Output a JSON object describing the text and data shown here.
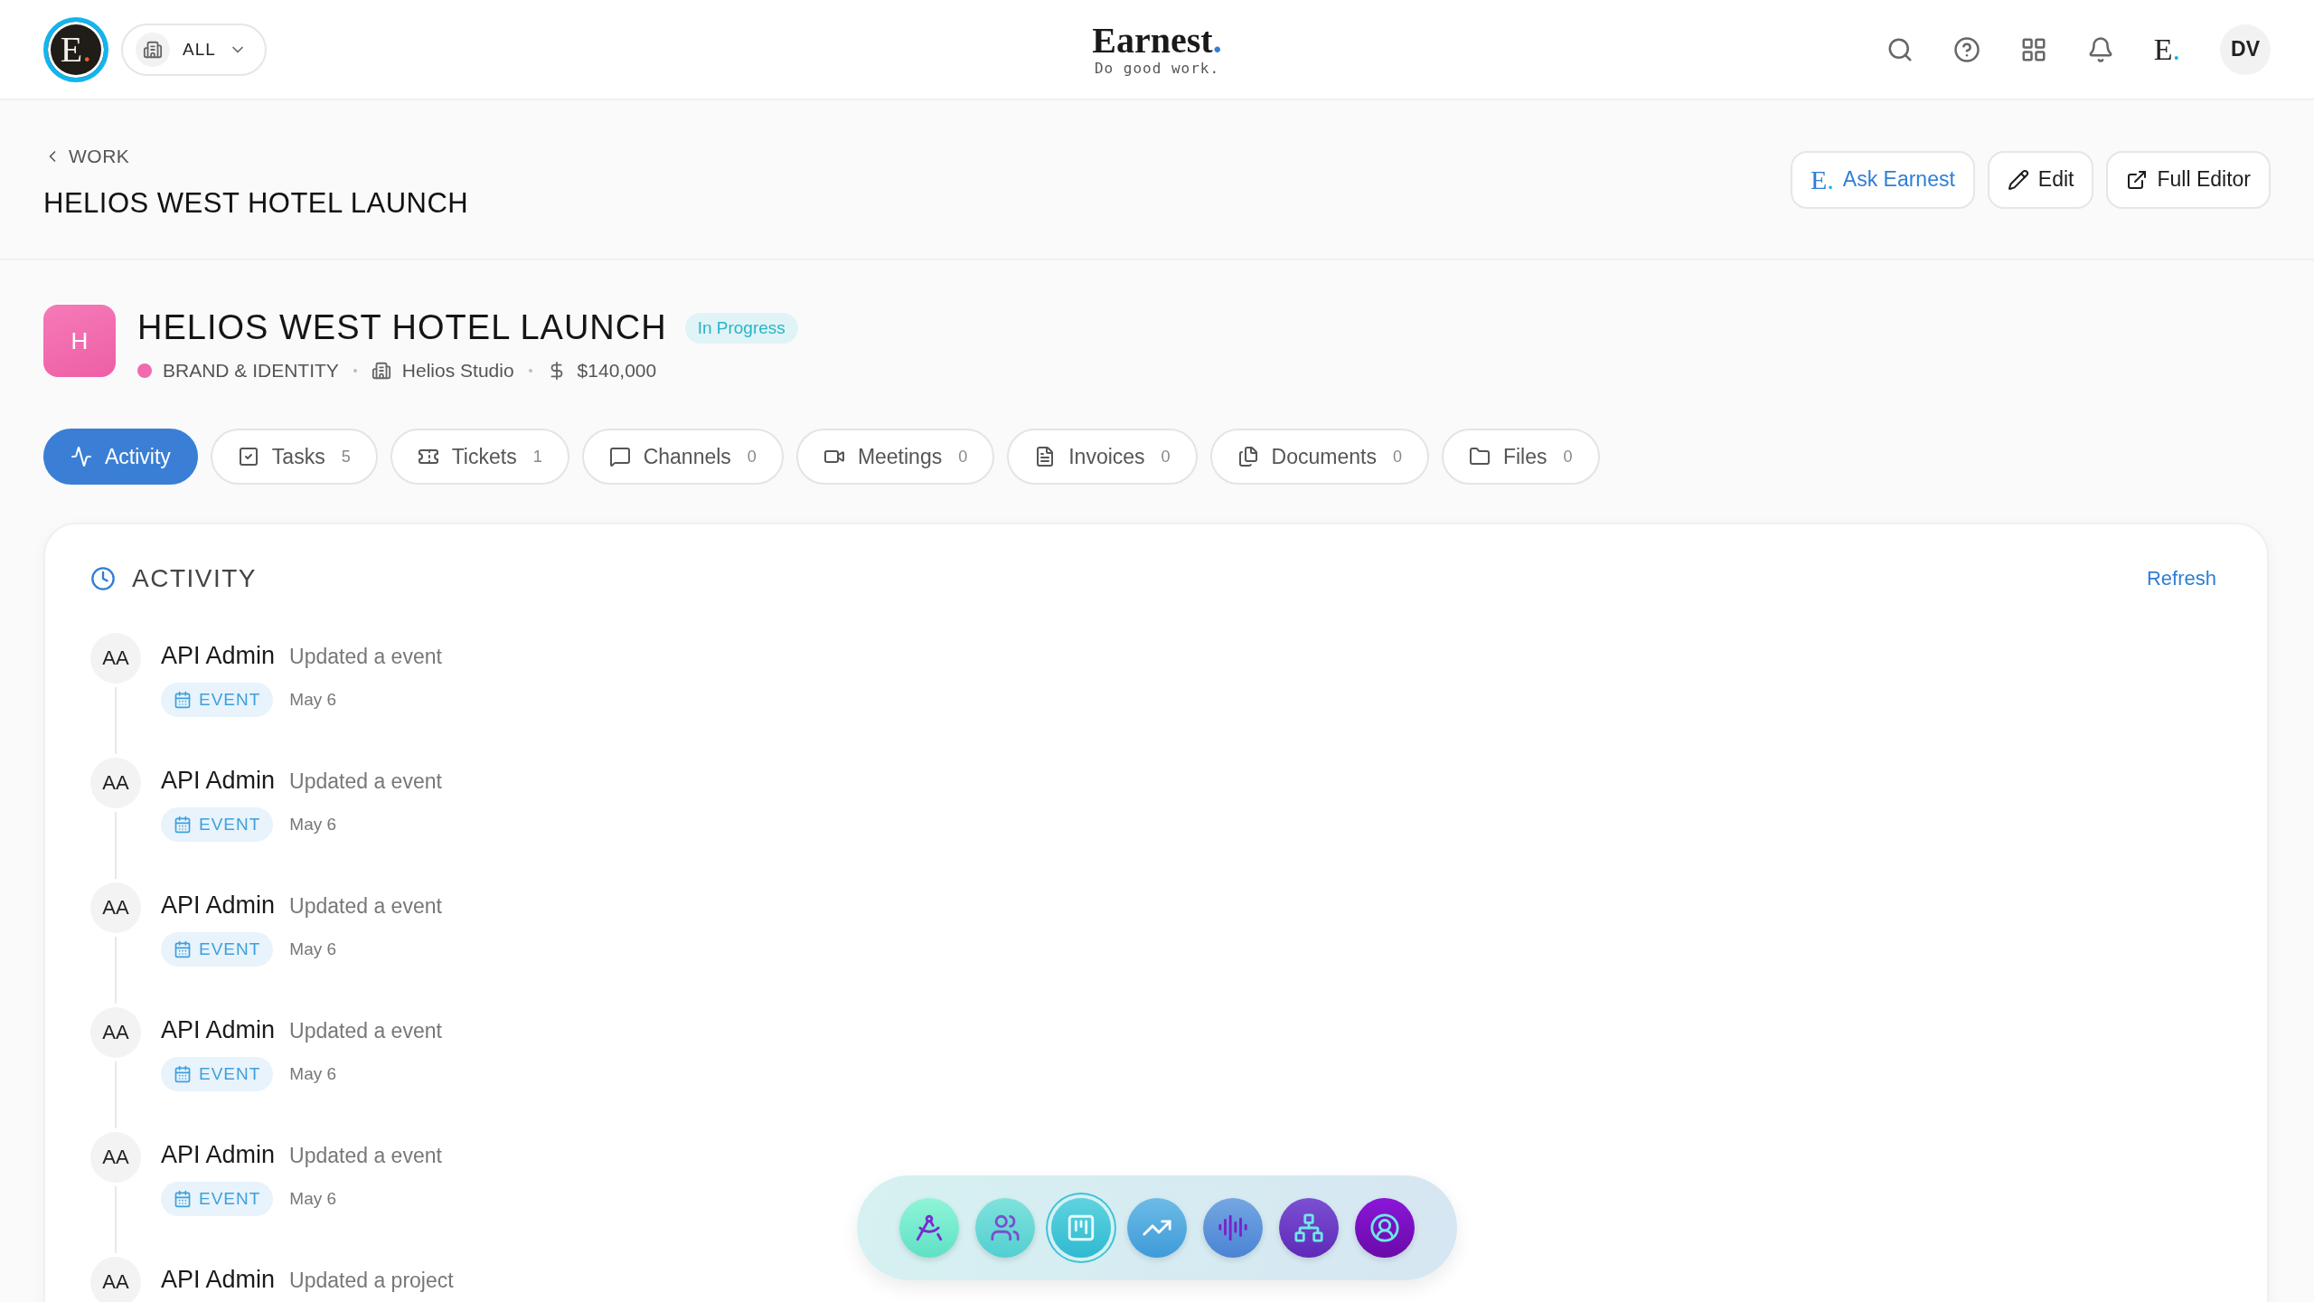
{
  "topbar": {
    "logo": {
      "letter": "E",
      "dot": "."
    },
    "workspace": {
      "label": "ALL"
    },
    "brand": {
      "name": "Earnest",
      "dot": ".",
      "tagline": "Do good work."
    },
    "assistant": {
      "letter": "E",
      "dot": "."
    },
    "user": {
      "initials": "DV"
    }
  },
  "page_header": {
    "breadcrumb": "WORK",
    "title": "HELIOS WEST HOTEL LAUNCH",
    "actions": [
      {
        "kind": "assistant",
        "label": "Ask Earnest",
        "mark": "E",
        "dot": "."
      },
      {
        "kind": "edit",
        "label": "Edit"
      },
      {
        "kind": "open",
        "label": "Full Editor"
      }
    ]
  },
  "project": {
    "initial": "H",
    "title": "HELIOS WEST HOTEL LAUNCH",
    "status": "In Progress",
    "category": {
      "label": "BRAND & IDENTITY",
      "color": "#f06aae"
    },
    "client": "Helios Studio",
    "budget": "$140,000"
  },
  "tabs": [
    {
      "label": "Activity",
      "selected": true
    },
    {
      "label": "Tasks",
      "count": "5",
      "selected": false
    },
    {
      "label": "Tickets",
      "count": "1",
      "selected": false
    },
    {
      "label": "Channels",
      "count": "0",
      "selected": false
    },
    {
      "label": "Meetings",
      "count": "0",
      "selected": false
    },
    {
      "label": "Invoices",
      "count": "0",
      "selected": false
    },
    {
      "label": "Documents",
      "count": "0",
      "selected": false
    },
    {
      "label": "Files",
      "count": "0",
      "selected": false
    }
  ],
  "activity": {
    "title": "ACTIVITY",
    "refresh": "Refresh",
    "items": [
      {
        "initials": "AA",
        "user": "API Admin",
        "action": "Updated a event",
        "tag": "EVENT",
        "date": "May 6"
      },
      {
        "initials": "AA",
        "user": "API Admin",
        "action": "Updated a event",
        "tag": "EVENT",
        "date": "May 6"
      },
      {
        "initials": "AA",
        "user": "API Admin",
        "action": "Updated a event",
        "tag": "EVENT",
        "date": "May 6"
      },
      {
        "initials": "AA",
        "user": "API Admin",
        "action": "Updated a event",
        "tag": "EVENT",
        "date": "May 6"
      },
      {
        "initials": "AA",
        "user": "API Admin",
        "action": "Updated a event",
        "tag": "EVENT",
        "date": "May 6"
      },
      {
        "initials": "AA",
        "user": "API Admin",
        "action": "Updated a project"
      }
    ]
  },
  "dock": [
    {
      "selected": false
    },
    {
      "selected": false
    },
    {
      "selected": true
    },
    {
      "selected": false
    },
    {
      "selected": false
    },
    {
      "selected": false
    },
    {
      "selected": false
    }
  ]
}
